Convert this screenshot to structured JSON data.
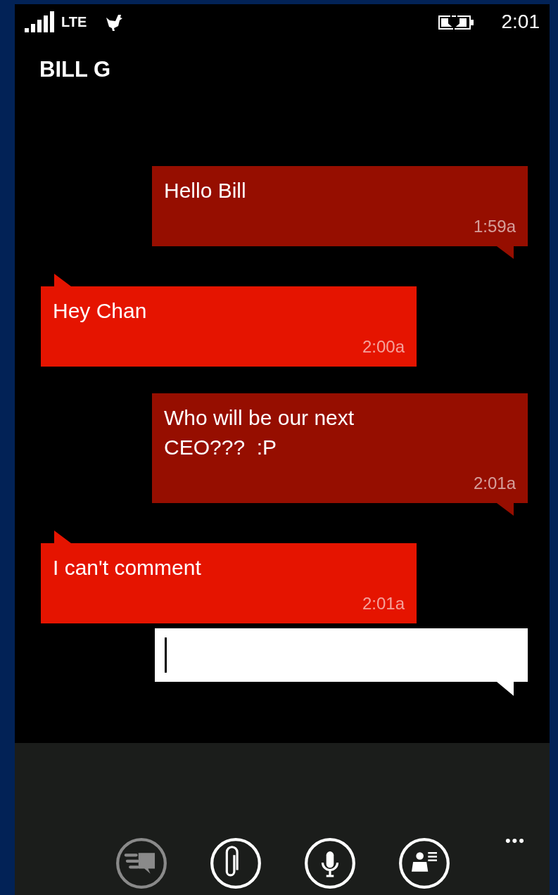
{
  "status_bar": {
    "network": "LTE",
    "time": "2:01"
  },
  "contact": {
    "name": "BILL G"
  },
  "messages": [
    {
      "kind": "sent",
      "text": "Hello Bill",
      "time": "1:59a"
    },
    {
      "kind": "received",
      "text": "Hey Chan",
      "time": "2:00a"
    },
    {
      "kind": "sent",
      "text": "Who will be our next CEO???  :P",
      "time": "2:01a"
    },
    {
      "kind": "received",
      "text": "I can't comment",
      "time": "2:01a"
    }
  ],
  "app_bar": {
    "buttons": [
      {
        "kind": "send",
        "disabled": true
      },
      {
        "kind": "attach",
        "disabled": false
      },
      {
        "kind": "voice",
        "disabled": false
      },
      {
        "kind": "contact",
        "disabled": false
      }
    ],
    "more": "•••"
  }
}
